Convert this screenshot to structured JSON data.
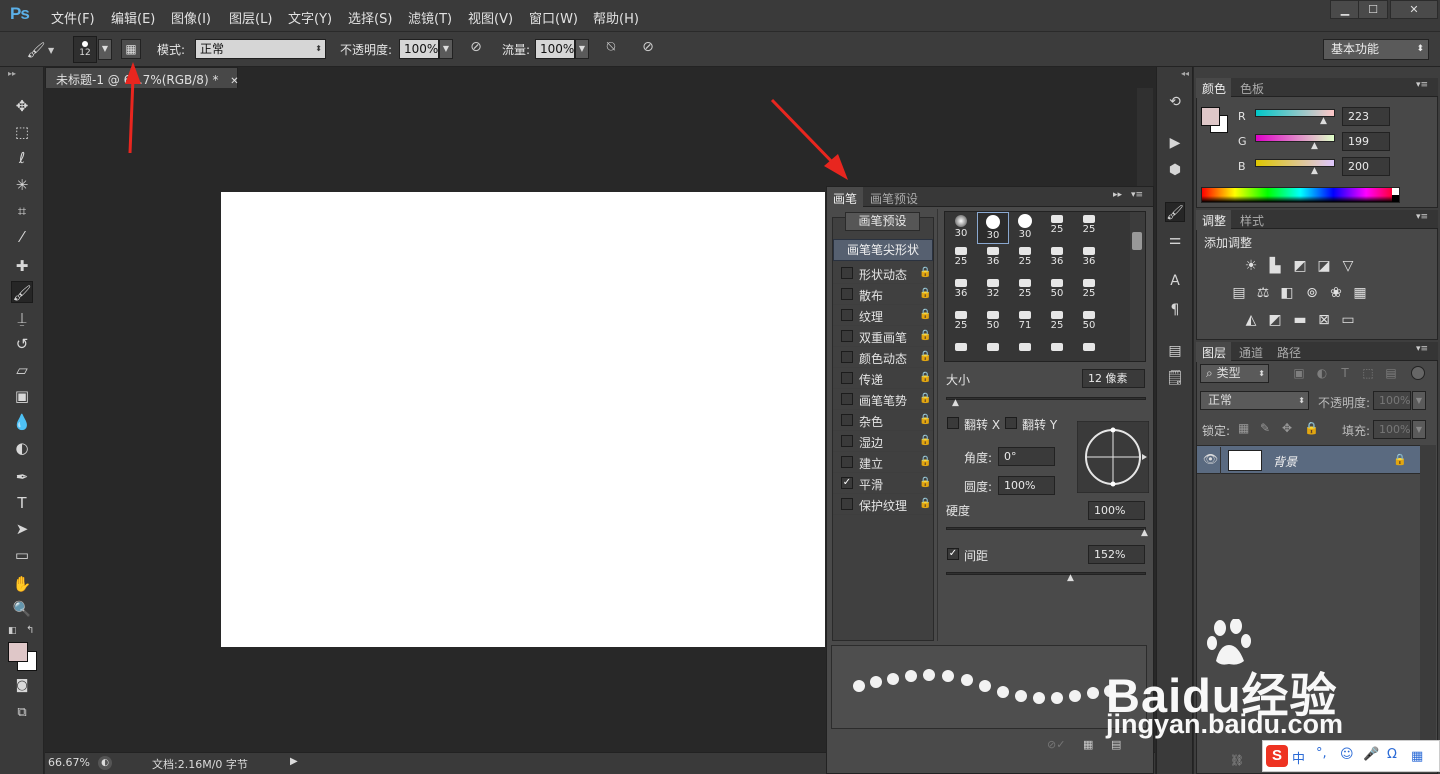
{
  "app": {
    "logo": "Ps"
  },
  "menu": [
    "文件(F)",
    "编辑(E)",
    "图像(I)",
    "图层(L)",
    "文字(Y)",
    "选择(S)",
    "滤镜(T)",
    "视图(V)",
    "窗口(W)",
    "帮助(H)"
  ],
  "window_controls": [
    "minimize-icon",
    "maximize-icon",
    "close-icon"
  ],
  "options": {
    "brush_size": "12",
    "mode_label": "模式:",
    "mode_value": "正常",
    "opacity_label": "不透明度:",
    "opacity_value": "100%",
    "flow_label": "流量:",
    "flow_value": "100%",
    "workspace": "基本功能"
  },
  "tools": [
    "move-tool-icon",
    "marquee-tool-icon",
    "lasso-tool-icon",
    "magic-wand-icon",
    "crop-tool-icon",
    "eyedropper-icon",
    "healing-brush-icon",
    "brush-tool-icon",
    "clone-stamp-icon",
    "history-brush-icon",
    "eraser-icon",
    "gradient-icon",
    "blur-tool-icon",
    "dodge-tool-icon",
    "pen-tool-icon",
    "type-tool-icon",
    "path-select-icon",
    "shape-tool-icon",
    "hand-tool-icon",
    "zoom-tool-icon"
  ],
  "colors": {
    "foreground": "#dfc7c8",
    "background": "#ffffff",
    "accent": "#5bb0e8"
  },
  "document": {
    "tab_title": "未标题-1 @ 66.7%(RGB/8) *",
    "zoom": "66.67%",
    "doc_info": "文档:2.16M/0 字节"
  },
  "brush_panel": {
    "tabs": [
      "画笔",
      "画笔预设"
    ],
    "preset_button": "画笔预设",
    "tip_shape_label": "画笔笔尖形状",
    "options": [
      {
        "label": "形状动态",
        "checked": false
      },
      {
        "label": "散布",
        "checked": false
      },
      {
        "label": "纹理",
        "checked": false
      },
      {
        "label": "双重画笔",
        "checked": false
      },
      {
        "label": "颜色动态",
        "checked": false
      },
      {
        "label": "传递",
        "checked": false
      },
      {
        "label": "画笔笔势",
        "checked": false
      },
      {
        "label": "杂色",
        "checked": false
      },
      {
        "label": "湿边",
        "checked": false
      },
      {
        "label": "建立",
        "checked": false
      },
      {
        "label": "平滑",
        "checked": true
      },
      {
        "label": "保护纹理",
        "checked": false
      }
    ],
    "tip_sizes": [
      "30",
      "30",
      "30",
      "25",
      "25",
      "25",
      "36",
      "25",
      "36",
      "36",
      "36",
      "32",
      "25",
      "50",
      "25",
      "25",
      "50",
      "71",
      "25",
      "50",
      "",
      "",
      "",
      "",
      ""
    ],
    "size_label": "大小",
    "size_value": "12 像素",
    "flip_x_label": "翻转 X",
    "flip_y_label": "翻转 Y",
    "angle_label": "角度:",
    "angle_value": "0°",
    "roundness_label": "圆度:",
    "roundness_value": "100%",
    "hardness_label": "硬度",
    "hardness_value": "100%",
    "spacing_label": "间距",
    "spacing_value": "152%",
    "spacing_checked": true
  },
  "color_panel": {
    "tabs": [
      "颜色",
      "色板"
    ],
    "channels": [
      {
        "label": "R",
        "value": "223"
      },
      {
        "label": "G",
        "value": "199"
      },
      {
        "label": "B",
        "value": "200"
      }
    ]
  },
  "adjust_panel": {
    "tabs": [
      "调整",
      "样式"
    ],
    "add_label": "添加调整"
  },
  "layers_panel": {
    "tabs": [
      "图层",
      "通道",
      "路径"
    ],
    "filter_label": "类型",
    "blend_mode": "正常",
    "opacity_label": "不透明度:",
    "opacity_value": "100%",
    "lock_label": "锁定:",
    "fill_label": "填充:",
    "fill_value": "100%",
    "layer_name": "背景"
  },
  "watermark": {
    "brand": "Baidu经验",
    "url": "jingyan.baidu.com"
  },
  "ime": [
    "中",
    "°,",
    "☺",
    "🎤",
    "Ω"
  ]
}
